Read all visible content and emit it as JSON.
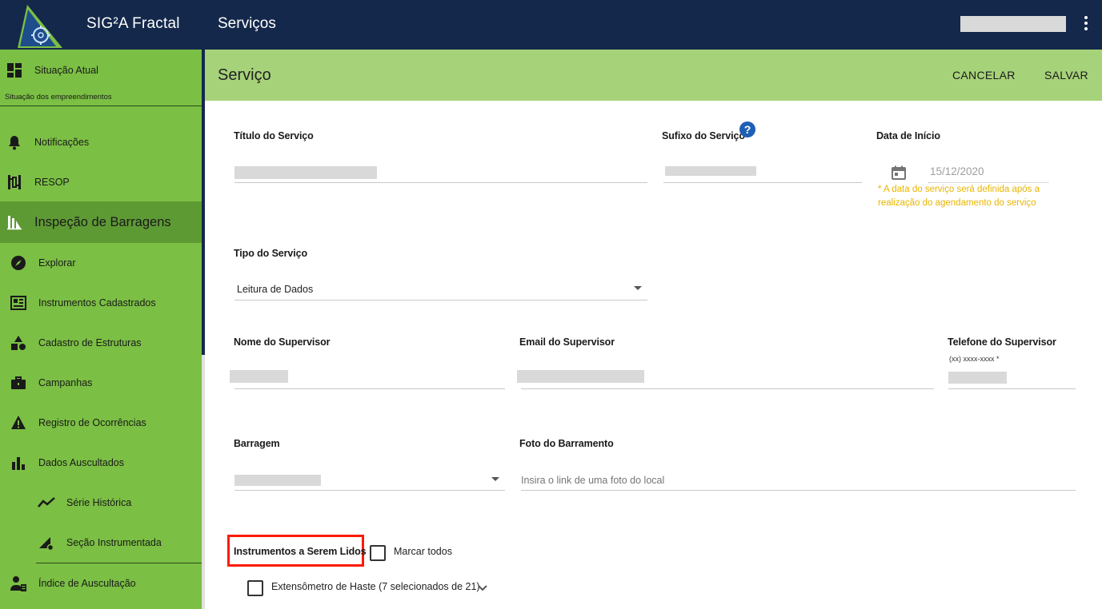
{
  "topbar": {
    "app_title": "SIG²A Fractal",
    "section": "Serviços",
    "brand_color": "#14284b"
  },
  "sidebar": {
    "items": [
      {
        "label": "Situação Atual",
        "icon": "dashboard-icon"
      },
      {
        "label": "Notificações",
        "icon": "bell-icon"
      },
      {
        "label": "RESOP",
        "icon": "resop-icon"
      },
      {
        "label": "Inspeção de Barragens",
        "icon": "dam-icon"
      },
      {
        "label": "Explorar",
        "icon": "compass-icon"
      },
      {
        "label": "Instrumentos Cadastrados",
        "icon": "instrument-icon"
      },
      {
        "label": "Cadastro de Estruturas",
        "icon": "shapes-icon"
      },
      {
        "label": "Campanhas",
        "icon": "briefcase-icon"
      },
      {
        "label": "Registro de Ocorrências",
        "icon": "warning-icon"
      },
      {
        "label": "Dados Auscultados",
        "icon": "bar-chart-icon"
      },
      {
        "label": "Série Histórica",
        "icon": "trend-icon"
      },
      {
        "label": "Seção Instrumentada",
        "icon": "section-icon"
      },
      {
        "label": "Índice de Auscultação",
        "icon": "worker-icon"
      }
    ],
    "subtitle": "Situação dos empreendimentos",
    "color": "#7bbf44"
  },
  "content": {
    "title": "Serviço",
    "cancel": "CANCELAR",
    "save": "SALVAR",
    "header_color": "#a6d279"
  },
  "form": {
    "titulo_label": "Título do Serviço",
    "sufixo_label": "Sufixo do Serviço",
    "data_label": "Data de Início",
    "data_value": "15/12/2020",
    "data_hint": "* A data do serviço será definida após a realização do agendamento do serviço",
    "tipo_label": "Tipo do Serviço",
    "tipo_value": "Leitura de Dados",
    "supervisor_label": "Nome do Supervisor",
    "email_label": "Email do Supervisor",
    "telefone_label": "Telefone do Supervisor",
    "telefone_hint": "(xx) xxxx-xxxx *",
    "barragem_label": "Barragem",
    "foto_label": "Foto do Barramento",
    "foto_placeholder": "Insira o link de uma foto do local",
    "instrumentos_label": "Instrumentos a Serem Lidos",
    "marcar_todos": "Marcar todos",
    "extensometro": "Extensômetro de Haste (7 selecionados de 21)"
  }
}
